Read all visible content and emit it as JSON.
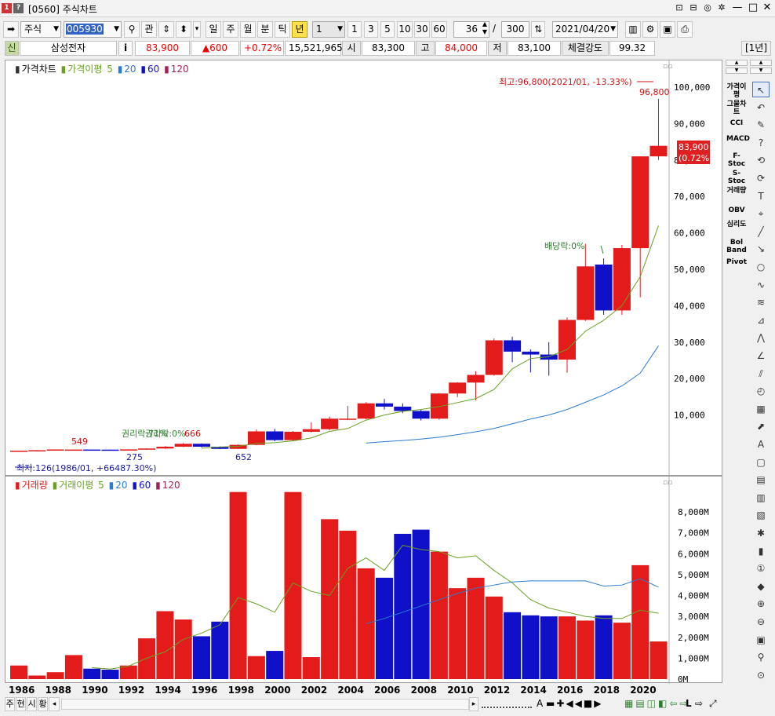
{
  "window": {
    "title": "[0560] 주식차트",
    "icons": [
      "app-number-icon",
      "help-icon"
    ],
    "app_badge": "1",
    "help_badge": "?",
    "controls": [
      "restore-icon",
      "minimize-icon",
      "maximize-icon",
      "close-icon"
    ]
  },
  "toolbar": {
    "market": "주식",
    "code": "005930",
    "search_icon": "magnifier-icon",
    "link_label": "관",
    "period_tabs": [
      "일",
      "주",
      "월",
      "분",
      "틱",
      "년"
    ],
    "active_period": "년",
    "unit_value": "1",
    "unit_buttons": [
      "1",
      "3",
      "5",
      "10",
      "30",
      "60"
    ],
    "count": "36",
    "total": "300",
    "date": "2021/04/20"
  },
  "info": {
    "badge": "신",
    "name": "삼성전자",
    "info_label": "i",
    "price": "83,900",
    "change": "▲600",
    "change_pct": "+0.72%",
    "volume": "15,521,965",
    "open_label": "시",
    "open": "83,300",
    "high_label": "고",
    "high": "84,000",
    "low_label": "저",
    "low": "83,100",
    "strength_label": "체결강도",
    "strength": "99.32",
    "period_badge": "[1년]"
  },
  "price_panel": {
    "legend": {
      "name": "가격차트",
      "ma_label": "가격이평",
      "ma": [
        "5",
        "20",
        "60",
        "120"
      ]
    },
    "y_ticks": [
      "100,000",
      "90,000",
      "80,000",
      "70,000",
      "60,000",
      "50,000",
      "40,000",
      "30,000",
      "20,000",
      "10,000"
    ],
    "high_annotation": "최고:96,800(2021/01, -13.33%)",
    "high_value": "96,800",
    "low_annotation": "최저:126(1986/01, +66487.30%)",
    "current_price": "83,900",
    "current_pct": "(0.72%)",
    "dividend_label": "배당락:0%",
    "rights_label": "권리락:71%",
    "rights_label2": "권리락:0%",
    "marker_549": "549",
    "marker_275": "275",
    "marker_666": "666",
    "marker_652": "652"
  },
  "volume_panel": {
    "legend": {
      "name": "거래량",
      "ma_label": "거래이평",
      "ma": [
        "5",
        "20",
        "60",
        "120"
      ]
    },
    "y_ticks": [
      "8,000M",
      "7,000M",
      "6,000M",
      "5,000M",
      "4,000M",
      "3,000M",
      "2,000M",
      "1,000M",
      "0M"
    ]
  },
  "x_labels": [
    "1986",
    "1988",
    "1990",
    "1992",
    "1994",
    "1996",
    "1998",
    "2000",
    "2002",
    "2004",
    "2006",
    "2008",
    "2010",
    "2012",
    "2014",
    "2016",
    "2018",
    "2020"
  ],
  "sidebar": {
    "indicators": [
      "가격이평",
      "그물차트",
      "CCI",
      "MACD",
      "F-Stoc",
      "S-Stoc",
      "거래량",
      "OBV",
      "심리도",
      "Bol Band",
      "Pivot"
    ],
    "tools": [
      "cursor-icon",
      "undo-icon",
      "eraser-icon",
      "help-icon",
      "rotate-left-icon",
      "rotate-right-icon",
      "text-icon",
      "magnet-icon",
      "line-icon",
      "ray-icon",
      "circle-icon",
      "wave-icon",
      "fibonacci-icon",
      "gann-icon",
      "fan-icon",
      "angle-icon",
      "channel-icon",
      "cycle-icon",
      "grid-icon",
      "trend-icon",
      "auto-icon",
      "window-icon",
      "doc-icon",
      "chart-icon",
      "compare-icon",
      "settings-icon",
      "candle-icon",
      "number-icon",
      "mark-icon",
      "zoom-in-icon",
      "zoom-out-icon",
      "excel-icon",
      "search-icon",
      "pin-icon"
    ]
  },
  "bottom": {
    "tabs": [
      "주",
      "현",
      "시",
      "황"
    ],
    "zoom_label": "A"
  },
  "chart_data": {
    "type": "candlestick",
    "title": "",
    "years": [
      1986,
      1987,
      1988,
      1989,
      1990,
      1991,
      1992,
      1993,
      1994,
      1995,
      1996,
      1997,
      1998,
      1999,
      2000,
      2001,
      2002,
      2003,
      2004,
      2005,
      2006,
      2007,
      2008,
      2009,
      2010,
      2011,
      2012,
      2013,
      2014,
      2015,
      2016,
      2017,
      2018,
      2019,
      2020,
      2021
    ],
    "candles": [
      {
        "o": 126,
        "c": 200,
        "h": 220,
        "l": 126
      },
      {
        "o": 200,
        "c": 330,
        "h": 360,
        "l": 190
      },
      {
        "o": 330,
        "c": 549,
        "h": 549,
        "l": 300
      },
      {
        "o": 500,
        "c": 520,
        "h": 560,
        "l": 420
      },
      {
        "o": 520,
        "c": 500,
        "h": 540,
        "l": 300
      },
      {
        "o": 500,
        "c": 470,
        "h": 520,
        "l": 275
      },
      {
        "o": 470,
        "c": 560,
        "h": 580,
        "l": 380
      },
      {
        "o": 560,
        "c": 800,
        "h": 850,
        "l": 500
      },
      {
        "o": 800,
        "c": 1300,
        "h": 1420,
        "l": 760
      },
      {
        "o": 1300,
        "c": 2100,
        "h": 2300,
        "l": 1200
      },
      {
        "o": 2100,
        "c": 1300,
        "h": 2200,
        "l": 1100
      },
      {
        "o": 1300,
        "c": 700,
        "h": 1400,
        "l": 652
      },
      {
        "o": 700,
        "c": 1800,
        "h": 1900,
        "l": 652
      },
      {
        "o": 1800,
        "c": 5500,
        "h": 6000,
        "l": 1700
      },
      {
        "o": 5500,
        "c": 3100,
        "h": 6200,
        "l": 2800
      },
      {
        "o": 3100,
        "c": 5400,
        "h": 5600,
        "l": 2900
      },
      {
        "o": 5400,
        "c": 6100,
        "h": 8000,
        "l": 5200
      },
      {
        "o": 6100,
        "c": 9000,
        "h": 9600,
        "l": 5800
      },
      {
        "o": 9000,
        "c": 9000,
        "h": 12500,
        "l": 8600
      },
      {
        "o": 9000,
        "c": 13200,
        "h": 13500,
        "l": 8800
      },
      {
        "o": 13200,
        "c": 12300,
        "h": 14400,
        "l": 11500
      },
      {
        "o": 12300,
        "c": 11100,
        "h": 13200,
        "l": 10500
      },
      {
        "o": 11100,
        "c": 9000,
        "h": 11500,
        "l": 8500
      },
      {
        "o": 9000,
        "c": 15900,
        "h": 16000,
        "l": 8700
      },
      {
        "o": 15900,
        "c": 18900,
        "h": 19000,
        "l": 14900
      },
      {
        "o": 18900,
        "c": 21000,
        "h": 22000,
        "l": 14000
      },
      {
        "o": 21000,
        "c": 30500,
        "h": 31000,
        "l": 20800
      },
      {
        "o": 30500,
        "c": 27400,
        "h": 31500,
        "l": 24500
      },
      {
        "o": 27400,
        "c": 26600,
        "h": 28000,
        "l": 21700
      },
      {
        "o": 26600,
        "c": 25200,
        "h": 30000,
        "l": 20800
      },
      {
        "o": 25200,
        "c": 36100,
        "h": 36800,
        "l": 21600
      },
      {
        "o": 36100,
        "c": 50800,
        "h": 57000,
        "l": 35800
      },
      {
        "o": 51300,
        "c": 38700,
        "h": 53000,
        "l": 37500
      },
      {
        "o": 38700,
        "c": 55800,
        "h": 56700,
        "l": 37500
      },
      {
        "o": 55800,
        "c": 81000,
        "h": 81000,
        "l": 42300
      },
      {
        "o": 81000,
        "c": 83900,
        "h": 96800,
        "l": 80000
      }
    ],
    "price_ma5": [
      null,
      null,
      null,
      null,
      null,
      null,
      null,
      null,
      null,
      null,
      900,
      1200,
      1400,
      2200,
      2400,
      2900,
      3700,
      5500,
      6300,
      8600,
      10000,
      11000,
      11500,
      12300,
      13400,
      14500,
      17000,
      22700,
      25500,
      26000,
      28000,
      33000,
      36000,
      40000,
      48000,
      62000
    ],
    "price_ma20": [
      null,
      null,
      null,
      null,
      null,
      null,
      null,
      null,
      null,
      null,
      null,
      null,
      null,
      null,
      null,
      null,
      null,
      null,
      null,
      2300,
      2700,
      3000,
      3400,
      3900,
      4600,
      5400,
      6300,
      7600,
      8900,
      10000,
      11500,
      13500,
      15500,
      18000,
      21500,
      29000
    ],
    "volume_millions": [
      650,
      170,
      330,
      1150,
      500,
      450,
      650,
      1950,
      3250,
      2850,
      2050,
      2750,
      8950,
      1100,
      1350,
      8950,
      1050,
      7650,
      7100,
      5300,
      4850,
      6950,
      7150,
      6100,
      4350,
      4850,
      3950,
      3200,
      3050,
      3000,
      3000,
      2800,
      3050,
      2700,
      5450,
      1800
    ],
    "volume_ma5": [
      null,
      null,
      null,
      null,
      550,
      480,
      620,
      1000,
      1300,
      1900,
      2200,
      2600,
      3900,
      3600,
      3200,
      4600,
      4200,
      4000,
      5300,
      5800,
      5200,
      6400,
      6200,
      6100,
      5800,
      5900,
      5200,
      4600,
      3800,
      3400,
      3200,
      3000,
      2900,
      2900,
      3300,
      3150
    ],
    "volume_ma20": [
      null,
      null,
      null,
      null,
      null,
      null,
      null,
      null,
      null,
      null,
      null,
      null,
      null,
      null,
      null,
      null,
      null,
      null,
      null,
      2650,
      2900,
      3200,
      3500,
      3800,
      4100,
      4350,
      4500,
      4650,
      4700,
      4700,
      4700,
      4700,
      4450,
      4500,
      4800,
      4400
    ],
    "price_ylim": [
      0,
      100000
    ],
    "volume_ylim": [
      0,
      8000
    ],
    "xlabel": "",
    "ylabel": "",
    "up_color": "#e31b1b",
    "down_color": "#1010c8",
    "ma5_color": "#6aa022",
    "ma20_color": "#2b7bd0"
  }
}
